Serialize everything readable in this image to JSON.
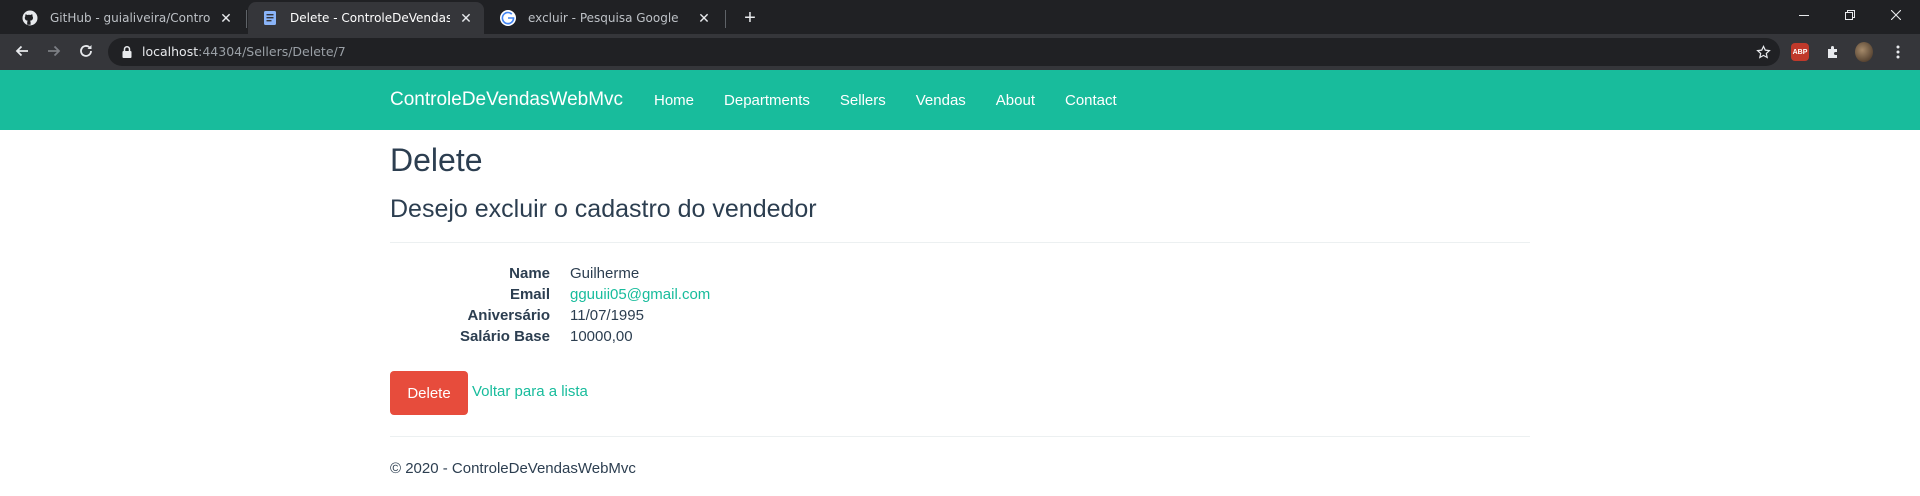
{
  "browser": {
    "tabs": [
      {
        "title": "GitHub - guialiveira/ControleDeV",
        "icon": "github-icon"
      },
      {
        "title": "Delete - ControleDeVendasWebMv",
        "icon": "document-icon"
      },
      {
        "title": "excluir - Pesquisa Google",
        "icon": "google-icon"
      }
    ],
    "url_host": "localhost",
    "url_rest": ":44304/Sellers/Delete/7",
    "extensions": {
      "abp_label": "ABP"
    }
  },
  "site": {
    "brand": "ControleDeVendasWebMvc",
    "nav": [
      "Home",
      "Departments",
      "Sellers",
      "Vendas",
      "About",
      "Contact"
    ],
    "colors": {
      "navbar": "#18bc9c",
      "danger": "#e74c3c",
      "text": "#2c3e50"
    }
  },
  "page": {
    "title": "Delete",
    "subtitle": "Desejo excluir o cadastro do vendedor",
    "fields": [
      {
        "label": "Name",
        "value": "Guilherme"
      },
      {
        "label": "Email",
        "value": "gguuii05@gmail.com"
      },
      {
        "label": "Aniversário",
        "value": "11/07/1995"
      },
      {
        "label": "Salário Base",
        "value": "10000,00"
      }
    ],
    "delete_label": "Delete",
    "back_label": "Voltar para a lista",
    "footer": "© 2020 - ControleDeVendasWebMvc"
  }
}
